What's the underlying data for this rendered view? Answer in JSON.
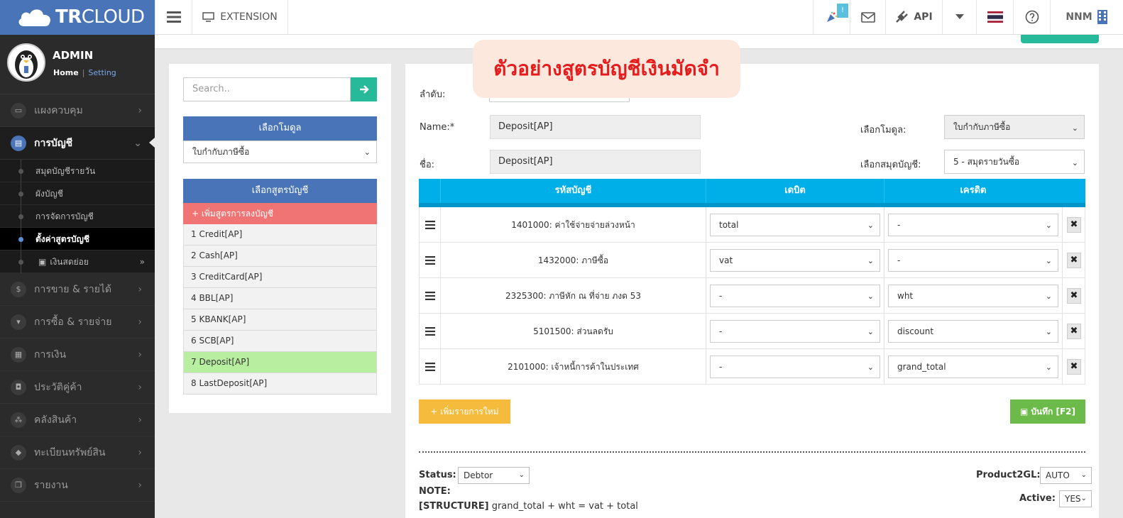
{
  "header": {
    "logo_bold": "TR",
    "logo_light": "CLOUD",
    "extension_label": "EXTENSION",
    "notification_badge": "!",
    "api_label": "API",
    "user_label": "NNM",
    "icons": [
      "hamburger-icon",
      "monitor-icon",
      "party-popper-icon",
      "mail-icon",
      "plug-icon",
      "caret-down-icon",
      "thai-flag-icon",
      "help-icon",
      "building-icon"
    ]
  },
  "profile": {
    "name": "ADMIN",
    "home_link": "Home",
    "separator": "|",
    "setting_link": "Setting"
  },
  "sidebar": {
    "items": [
      {
        "label": "แผงควบคุม",
        "icon": "monitor-icon",
        "active": false
      },
      {
        "label": "การบัญชี",
        "icon": "book-icon",
        "active": true
      },
      {
        "label": "การขาย & รายได้",
        "icon": "dollar-icon",
        "active": false
      },
      {
        "label": "การซื้อ & รายจ่าย",
        "icon": "cart-icon",
        "active": false
      },
      {
        "label": "การเงิน",
        "icon": "calendar-icon",
        "active": false
      },
      {
        "label": "ประวัติคู่ค้า",
        "icon": "contact-icon",
        "active": false
      },
      {
        "label": "คลังสินค้า",
        "icon": "boxes-icon",
        "active": false
      },
      {
        "label": "ทะเบียนทรัพย์สิน",
        "icon": "gem-icon",
        "active": false
      },
      {
        "label": "รายงาน",
        "icon": "copy-icon",
        "active": false
      }
    ],
    "subitems": [
      {
        "label": "สมุดบัญชีรายวัน",
        "active": false
      },
      {
        "label": "ผังบัญชี",
        "active": false
      },
      {
        "label": "การจัดการบัญชี",
        "active": false
      },
      {
        "label": "ตั้งค่าสูตรบัญชี",
        "active": true
      },
      {
        "label": "เงินสดย่อย",
        "active": false
      }
    ]
  },
  "left_panel": {
    "search_placeholder": "Search..",
    "module_header": "เลือกโมดูล",
    "module_value": "ใบกำกับภาษีซื้อ",
    "formula_header": "เลือกสูตรบัญชี",
    "add_formula_label": "+ เพิ่มสูตรการลงบัญชี",
    "formulas": [
      {
        "label": "1 Credit[AP]",
        "active": false
      },
      {
        "label": "2 Cash[AP]",
        "active": false
      },
      {
        "label": "3 CreditCard[AP]",
        "active": false
      },
      {
        "label": "4 BBL[AP]",
        "active": false
      },
      {
        "label": "5 KBANK[AP]",
        "active": false
      },
      {
        "label": "6 SCB[AP]",
        "active": false
      },
      {
        "label": "7 Deposit[AP]",
        "active": true
      },
      {
        "label": "8 LastDeposit[AP]",
        "active": false
      }
    ]
  },
  "banner": {
    "text": "ตัวอย่างสูตรบัญชีเงินมัดจำ"
  },
  "form": {
    "order_label": "ลำดับ:",
    "name_label": "Name:*",
    "name_value": "Deposit[AP]",
    "thai_name_label": "ชื่อ:",
    "thai_name_value": "Deposit[AP]",
    "module_label": "เลือกโมดูล:",
    "module_value": "ใบกำกับภาษีซื้อ",
    "journal_label": "เลือกสมุดบัญชี:",
    "journal_value": "5 - สมุดรายวันซื้อ"
  },
  "table": {
    "headers": {
      "account": "รหัสบัญชี",
      "debit": "เดบิต",
      "credit": "เครดิต"
    },
    "rows": [
      {
        "account": "1401000: ค่าใช้จ่ายจ่ายล่วงหน้า",
        "debit": "total",
        "credit": "-"
      },
      {
        "account": "1432000: ภาษีซื้อ",
        "debit": "vat",
        "credit": "-"
      },
      {
        "account": "2325300: ภาษีหัก ณ ที่จ่าย ภงด 53",
        "debit": "-",
        "credit": "wht"
      },
      {
        "account": "5101500: ส่วนลดรับ",
        "debit": "-",
        "credit": "discount"
      },
      {
        "account": "2101000: เจ้าหนี้การค้าในประเทศ",
        "debit": "-",
        "credit": "grand_total"
      }
    ],
    "delete_glyph": "✖"
  },
  "actions": {
    "add_row_label": "+ เพิ่มรายการใหม่",
    "save_label": "บันทึก [F2]"
  },
  "footer": {
    "status_label": "Status:",
    "status_value": "Debtor",
    "product2gl_label": "Product2GL:",
    "product2gl_value": "AUTO",
    "note_label": "NOTE:",
    "structure_label": "[STRUCTURE]",
    "structure_value": "grand_total + wht = vat + total",
    "active_label": "Active:",
    "active_value": "YES"
  },
  "colors": {
    "brand": "#4a74b8",
    "teal": "#26b99a",
    "table_header": "#00aee8",
    "add_formula": "#f07474",
    "active_formula": "#b8eea0",
    "add_row": "#f5bb3d",
    "save": "#6cbb4a",
    "banner_text": "#e61c1c"
  }
}
